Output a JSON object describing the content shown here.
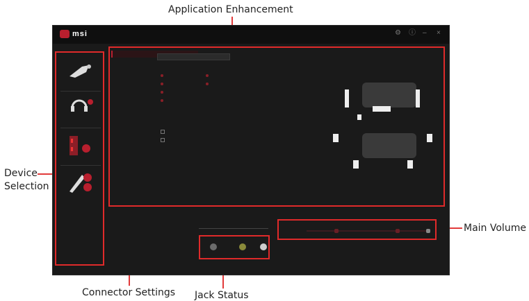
{
  "callouts": {
    "application_enhancement": "Application Enhancement",
    "device_selection_line1": "Device",
    "device_selection_line2": "Selection",
    "main_volume": "Main Volume",
    "connector_settings": "Connector Settings",
    "jack_status": "Jack Status"
  },
  "app": {
    "logo_text": "msi",
    "accent_color": "#b81f2e",
    "callout_line_color": "#e23a3a"
  },
  "icons": [
    "logo-icon",
    "gear-icon",
    "info-icon",
    "minimize-icon",
    "close-icon",
    "speaker-icon",
    "headphone-icon",
    "microphone-icon"
  ]
}
